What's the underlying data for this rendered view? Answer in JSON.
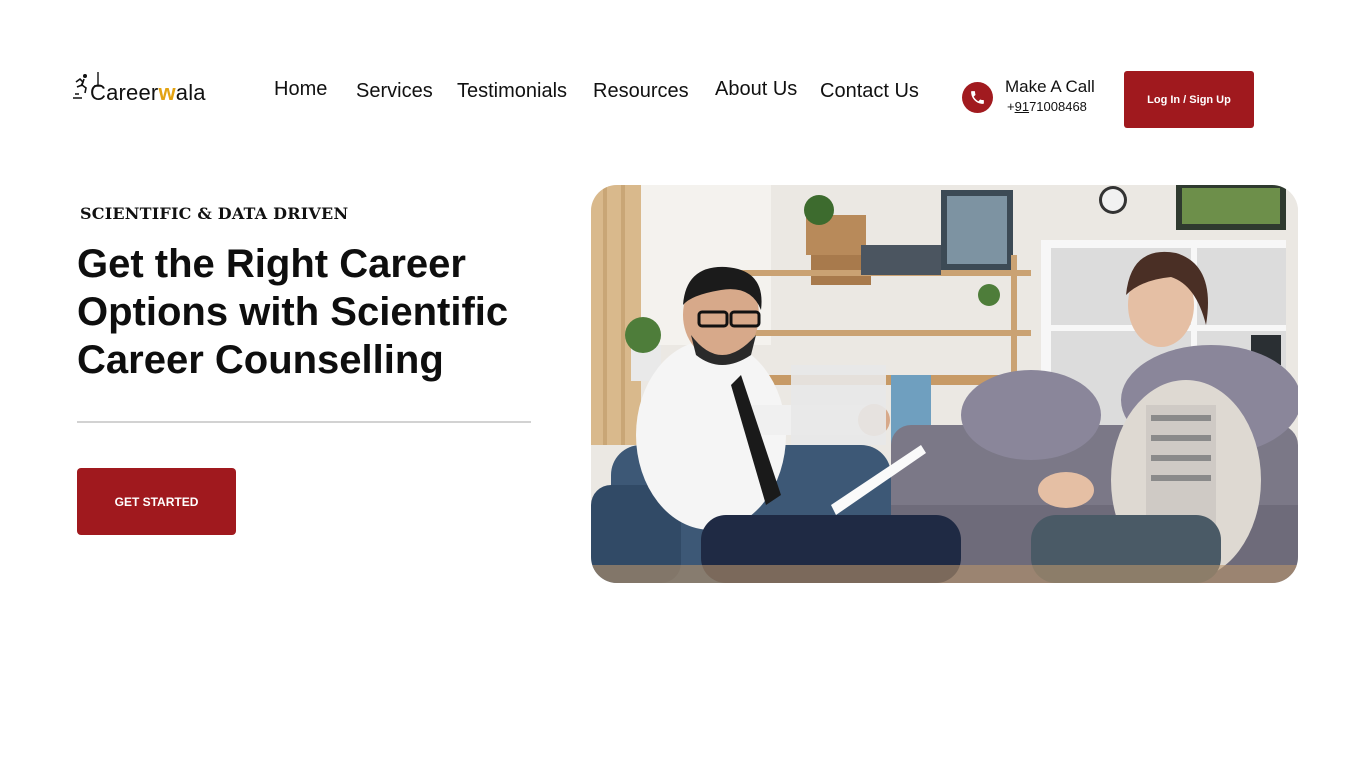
{
  "header": {
    "logo": {
      "text_start": "Career",
      "text_w": "w",
      "text_end": "ala",
      "icon": "runner-icon"
    },
    "nav": [
      {
        "label": "Home"
      },
      {
        "label": "Services"
      },
      {
        "label": "Testimonials"
      },
      {
        "label": "Resources"
      },
      {
        "label": "About Us"
      },
      {
        "label": "Contact Us"
      }
    ],
    "call": {
      "title": "Make A Call",
      "number": "+91 71008468",
      "number_prefix": "+",
      "number_underlined": "91",
      "number_rest": "71008468",
      "icon": "phone-icon"
    },
    "login_label": "Log In / Sign Up"
  },
  "hero": {
    "eyebrow": "SCIENTIFIC & DATA DRIVEN",
    "headline": "Get the Right Career Options with Scientific Career Counselling",
    "cta_label": "GET STARTED"
  },
  "colors": {
    "accent": "#a0191e",
    "logo_tick": "#e3a312",
    "divider": "#d2d2d2"
  }
}
